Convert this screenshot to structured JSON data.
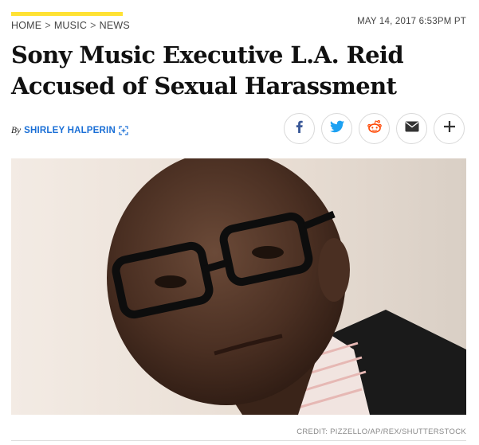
{
  "breadcrumb": {
    "items": [
      "HOME",
      "MUSIC",
      "NEWS"
    ],
    "separator": ">"
  },
  "dateline": "MAY 14, 2017 6:53PM PT",
  "headline": {
    "line1": "Sony Music Executive L.A. Reid",
    "line2": "Accused of Sexual Harassment"
  },
  "byline": {
    "prefix": "By",
    "author": "SHIRLEY HALPERIN"
  },
  "share": {
    "buttons": [
      {
        "name": "facebook",
        "icon": "facebook-icon",
        "color": "#3b5998"
      },
      {
        "name": "twitter",
        "icon": "twitter-icon",
        "color": "#1da1f2"
      },
      {
        "name": "reddit",
        "icon": "reddit-icon",
        "color": "#ff4500"
      },
      {
        "name": "email",
        "icon": "email-icon",
        "color": "#333333"
      },
      {
        "name": "more",
        "icon": "plus-icon",
        "color": "#333333"
      }
    ]
  },
  "photo": {
    "credit": "CREDIT: PIZZELLO/AP/REX/SHUTTERSTOCK"
  },
  "colors": {
    "accent": "#ffe234",
    "link": "#1a6fd6"
  }
}
